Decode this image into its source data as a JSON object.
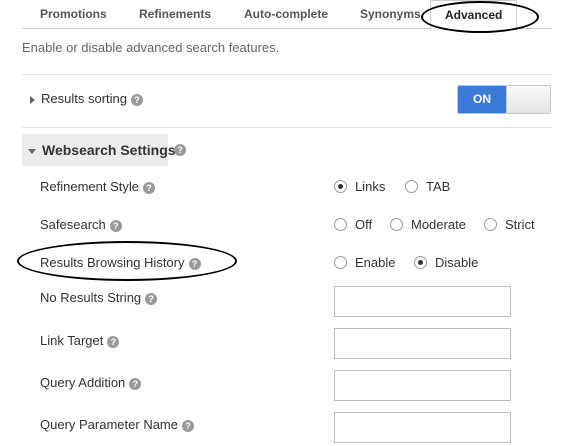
{
  "tabs": [
    {
      "label": "Promotions"
    },
    {
      "label": "Refinements"
    },
    {
      "label": "Auto-complete"
    },
    {
      "label": "Synonyms"
    },
    {
      "label": "Advanced",
      "active": true
    }
  ],
  "intro_text": "Enable or disable advanced search features.",
  "results_sorting": {
    "label": "Results sorting",
    "toggle_label": "ON",
    "enabled": true
  },
  "websearch": {
    "title": "Websearch Settings",
    "refinement_style": {
      "label": "Refinement Style",
      "options": [
        "Links",
        "TAB"
      ],
      "selected": "Links"
    },
    "safesearch": {
      "label": "Safesearch",
      "options": [
        "Off",
        "Moderate",
        "Strict"
      ],
      "selected": null
    },
    "results_browsing_history": {
      "label": "Results Browsing History",
      "options": [
        "Enable",
        "Disable"
      ],
      "selected": "Disable"
    },
    "no_results_string": {
      "label": "No Results String",
      "value": ""
    },
    "link_target": {
      "label": "Link Target",
      "value": ""
    },
    "query_addition": {
      "label": "Query Addition",
      "value": ""
    },
    "query_parameter_name": {
      "label": "Query Parameter Name",
      "value": ""
    }
  },
  "help_icon_glyph": "?",
  "colors": {
    "toggle_on": "#3b7bd8",
    "annotation": "#000000"
  }
}
